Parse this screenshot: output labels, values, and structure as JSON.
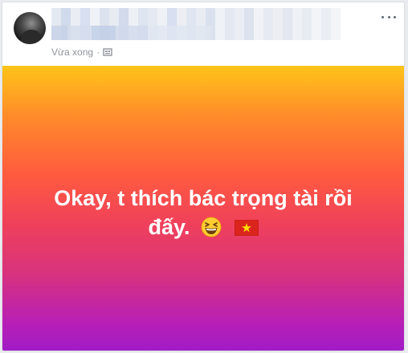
{
  "post": {
    "timestamp": "Vừa xong",
    "separator": "·",
    "text_line_1": "Okay, t thích bác trọng tài rồi",
    "text_line_2": "đấy.",
    "colors": {
      "card_background": "#ffffff",
      "meta_text": "#90949c",
      "gradient_top": "#ffc419",
      "gradient_bottom": "#a01cc7",
      "post_text": "#ffffff"
    },
    "icons": [
      "avatar",
      "audience-icon",
      "options-icon",
      "grinning-squinting-face-icon",
      "vietnam-flag-icon"
    ]
  }
}
